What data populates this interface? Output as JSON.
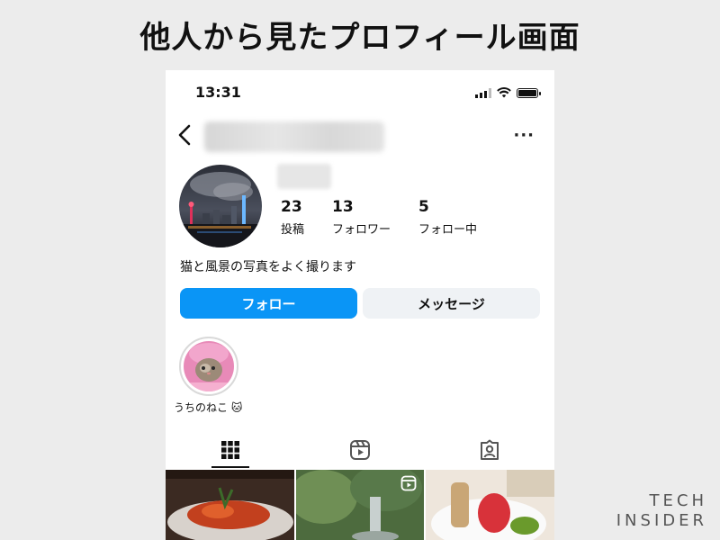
{
  "headline": "他人から見たプロフィール画面",
  "status_bar": {
    "time": "13:31"
  },
  "profile": {
    "stats": [
      {
        "count": "23",
        "label": "投稿"
      },
      {
        "count": "13",
        "label": "フォロワー"
      },
      {
        "count": "5",
        "label": "フォロー中"
      }
    ],
    "bio": "猫と風景の写真をよく撮ります"
  },
  "buttons": {
    "follow": "フォロー",
    "message": "メッセージ"
  },
  "highlight": {
    "label": "うちのねこ 🐱"
  },
  "tabs": [
    {
      "icon": "grid-icon",
      "active": true
    },
    {
      "icon": "reels-icon",
      "active": false
    },
    {
      "icon": "tagged-icon",
      "active": false
    }
  ],
  "watermark": {
    "line1": "TECH",
    "line2": "INSIDER"
  },
  "colors": {
    "follow_button": "#0a95f6",
    "message_button": "#eff2f5"
  }
}
